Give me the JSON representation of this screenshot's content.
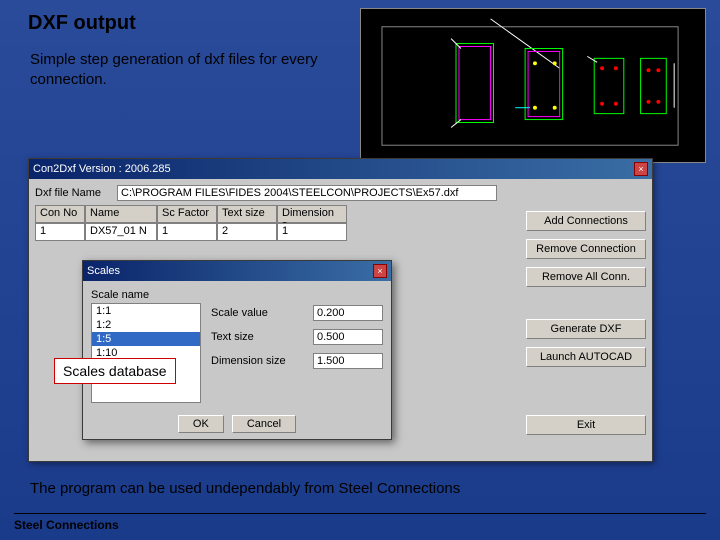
{
  "heading": "DXF output",
  "subheading": "Simple step generation of dxf files for every connection.",
  "footer_text": "The program can be used undependably from Steel Connections",
  "footer_label": "Steel Connections",
  "main_dialog": {
    "title": "Con2Dxf Version : 2006.285",
    "file_label": "Dxf file Name",
    "file_value": "C:\\PROGRAM FILES\\FIDES 2004\\STEELCON\\PROJECTS\\Ex57.dxf",
    "grid_headers": [
      "Con No",
      "Name",
      "Sc Factor",
      "Text size",
      "Dimension s"
    ],
    "grid_row": [
      "1",
      "DX57_01 N",
      "1",
      "2",
      "1"
    ],
    "buttons": {
      "add": "Add Connections",
      "remove": "Remove Connection",
      "remove_all": "Remove All Conn.",
      "generate": "Generate DXF",
      "launch": "Launch AUTOCAD",
      "exit": "Exit"
    }
  },
  "scales_dialog": {
    "title": "Scales",
    "list_label": "Scale name",
    "items": [
      "1:1",
      "1:2",
      "1:5",
      "1:10"
    ],
    "selected_index": 2,
    "fields": {
      "value_label": "Scale value",
      "value": "0.200",
      "text_label": "Text size",
      "text": "0.500",
      "dim_label": "Dimension size",
      "dim": "1.500"
    },
    "ok": "OK",
    "cancel": "Cancel"
  },
  "callout": "Scales database"
}
